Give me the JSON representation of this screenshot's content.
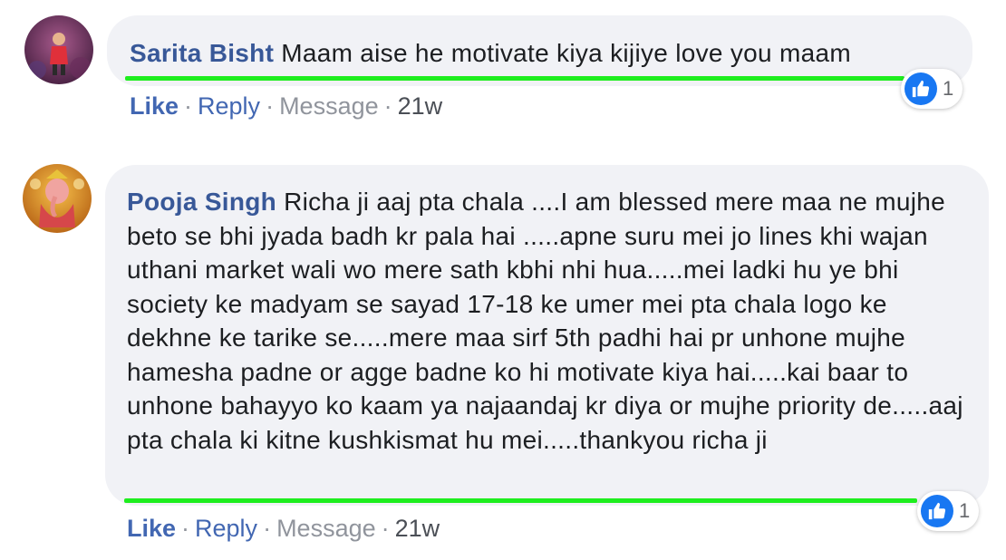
{
  "comments": [
    {
      "author": "Sarita Bisht",
      "text": "Maam aise he motivate kiya kijiye love you maam",
      "like_count": "1",
      "actions": {
        "like": "Like",
        "reply": "Reply",
        "message": "Message",
        "time": "21w",
        "separator": "·"
      }
    },
    {
      "author": "Pooja Singh",
      "text": "Richa ji aaj pta chala ....I am blessed mere maa ne mujhe beto se bhi jyada badh kr pala hai .....apne suru mei jo lines khi wajan uthani market wali wo mere sath kbhi nhi hua.....mei ladki hu ye bhi society ke madyam se sayad 17-18 ke umer mei pta chala logo ke dekhne ke tarike se.....mere maa sirf 5th padhi hai pr unhone mujhe hamesha padne or agge badne ko hi motivate kiya hai.....kai baar to unhone bahayyo ko kaam ya najaandaj kr diya or mujhe priority de.....aaj pta chala ki kitne kushkismat hu mei.....thankyou richa ji",
      "like_count": "1",
      "actions": {
        "like": "Like",
        "reply": "Reply",
        "message": "Message",
        "time": "21w",
        "separator": "·"
      }
    }
  ],
  "colors": {
    "author": "#385898",
    "bubble": "#f1f2f6",
    "highlight_underline": "#1eee1e",
    "like_blue": "#1877f2"
  },
  "icons": {
    "reaction": "like-thumb-icon"
  }
}
